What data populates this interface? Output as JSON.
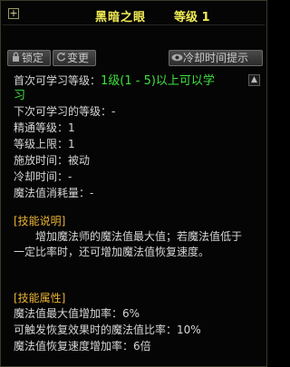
{
  "tooltip": {
    "expand_glyph": "+",
    "skill_name": "黑暗之眼",
    "level_text": "等级 1"
  },
  "buttons": {
    "lock": "锁定",
    "change": "变更",
    "cooldown_hint": "冷却时间提示"
  },
  "stats": {
    "first_learn_label": "首次可学习等级：",
    "first_learn_value_line1": "1级(1 - 5)以上可以学",
    "first_learn_value_line2": "习",
    "next_learn": "下次可学习的等级：-",
    "mastery": "精通等级：1",
    "max_level": "等级上限：1",
    "cast_time": "施放时间：被动",
    "cooldown": "冷却时间：-",
    "mp_cost": "魔法值消耗量：-"
  },
  "description": {
    "header": "[技能说明]",
    "text": "　　增加魔法师的魔法值最大值；若魔法值低于一定比率时，还可增加魔法值恢复速度。"
  },
  "attributes": {
    "header": "[技能属性]",
    "line1": "魔法值最大值增加率：6%",
    "line2": "可触发恢复效果时的魔法值比率：10%",
    "line3": "魔法值恢复速度增加率：6倍"
  }
}
